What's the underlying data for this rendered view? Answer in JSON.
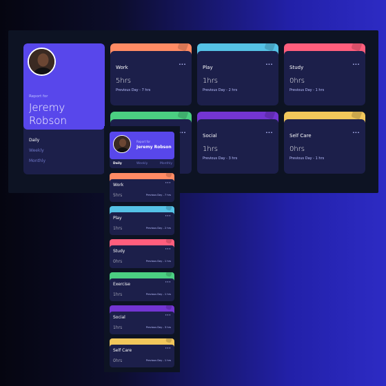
{
  "profile": {
    "report_for": "Report for",
    "name": "Jeremy Robson",
    "periods": [
      "Daily",
      "Weekly",
      "Monthly"
    ],
    "active_period": "Daily"
  },
  "colors": {
    "accent": "#5847eb",
    "card_bg": "#1c1f4a",
    "page_bg": "#0d1323",
    "work": "#ff8b64",
    "play": "#55c2e6",
    "study": "#ff5e7d",
    "exercise": "#4bcf82",
    "social": "#7335d2",
    "self_care": "#f1c75b"
  },
  "desktop_cards": [
    {
      "title": "Work",
      "hours": "5hrs",
      "previous": "Previous Day - 7 hrs",
      "color": "#ff8b64",
      "icon": "briefcase-icon"
    },
    {
      "title": "Play",
      "hours": "1hrs",
      "previous": "Previous Day - 2 hrs",
      "color": "#55c2e6",
      "icon": "gamepad-icon"
    },
    {
      "title": "Study",
      "hours": "0hrs",
      "previous": "Previous Day - 1 hrs",
      "color": "#ff5e7d",
      "icon": "book-icon"
    },
    {
      "title": "",
      "hours": "",
      "previous": "",
      "color": "#4bcf82",
      "icon": "running-icon"
    },
    {
      "title": "Social",
      "hours": "1hrs",
      "previous": "Previous Day - 3 hrs",
      "color": "#7335d2",
      "icon": "chat-icon"
    },
    {
      "title": "Self Care",
      "hours": "0hrs",
      "previous": "Previous Day - 1 hrs",
      "color": "#f1c75b",
      "icon": "heart-icon"
    }
  ],
  "mobile_cards": [
    {
      "title": "Work",
      "hours": "5hrs",
      "previous": "Previous Day - 7 hrs",
      "color": "#ff8b64"
    },
    {
      "title": "Play",
      "hours": "1hrs",
      "previous": "Previous Day - 2 hrs",
      "color": "#55c2e6"
    },
    {
      "title": "Study",
      "hours": "0hrs",
      "previous": "Previous Day - 1 hrs",
      "color": "#ff5e7d"
    },
    {
      "title": "Exercise",
      "hours": "1hrs",
      "previous": "Previous Day - 1 hrs",
      "color": "#4bcf82"
    },
    {
      "title": "Social",
      "hours": "1hrs",
      "previous": "Previous Day - 3 hrs",
      "color": "#7335d2"
    },
    {
      "title": "Self Care",
      "hours": "0hrs",
      "previous": "Previous Day - 1 hrs",
      "color": "#f1c75b"
    }
  ],
  "menu_label": "···"
}
